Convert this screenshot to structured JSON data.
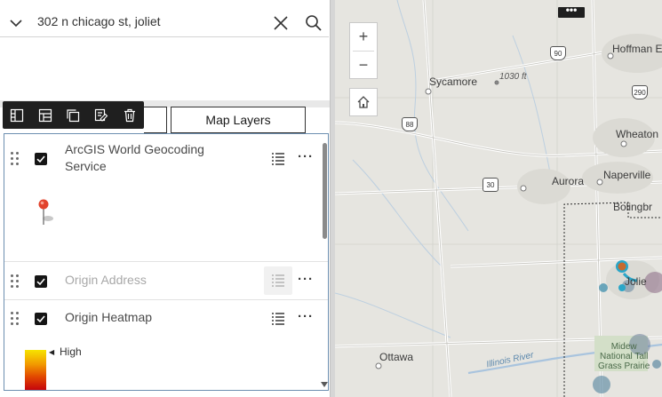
{
  "search": {
    "query": "302 n chicago st, joliet"
  },
  "tabs": {
    "map_layers": "Map Layers"
  },
  "layers": [
    {
      "name": "ArcGIS World Geocoding Service",
      "checked": true,
      "dimmed": false
    },
    {
      "name": "Origin Address",
      "checked": true,
      "dimmed": true
    },
    {
      "name": "Origin Heatmap",
      "checked": true,
      "dimmed": false
    }
  ],
  "heatmap_legend": {
    "high_label": "High"
  },
  "map": {
    "zoom_in": "+",
    "zoom_out": "−",
    "menu": "•••",
    "places": {
      "sycamore": "Sycamore",
      "hoffman": "Hoffman Est",
      "wheaton": "Wheaton",
      "naperville": "Naperville",
      "aurora": "Aurora",
      "bolingbrook": "Bolingbr",
      "joliet": "Jolie",
      "ottawa": "Ottawa",
      "midewin": "Midew\nNational Tall\nGrass Prairie",
      "elevation": "1030 ft",
      "river": "Illinois River"
    },
    "shields": {
      "i90": "90",
      "i290": "290",
      "i88": "88",
      "us30": "30"
    }
  },
  "colors": {
    "accent": "#2aa6c8",
    "panel_border": "#6d8fb0",
    "toolbar_bg": "#1f1f1f"
  }
}
